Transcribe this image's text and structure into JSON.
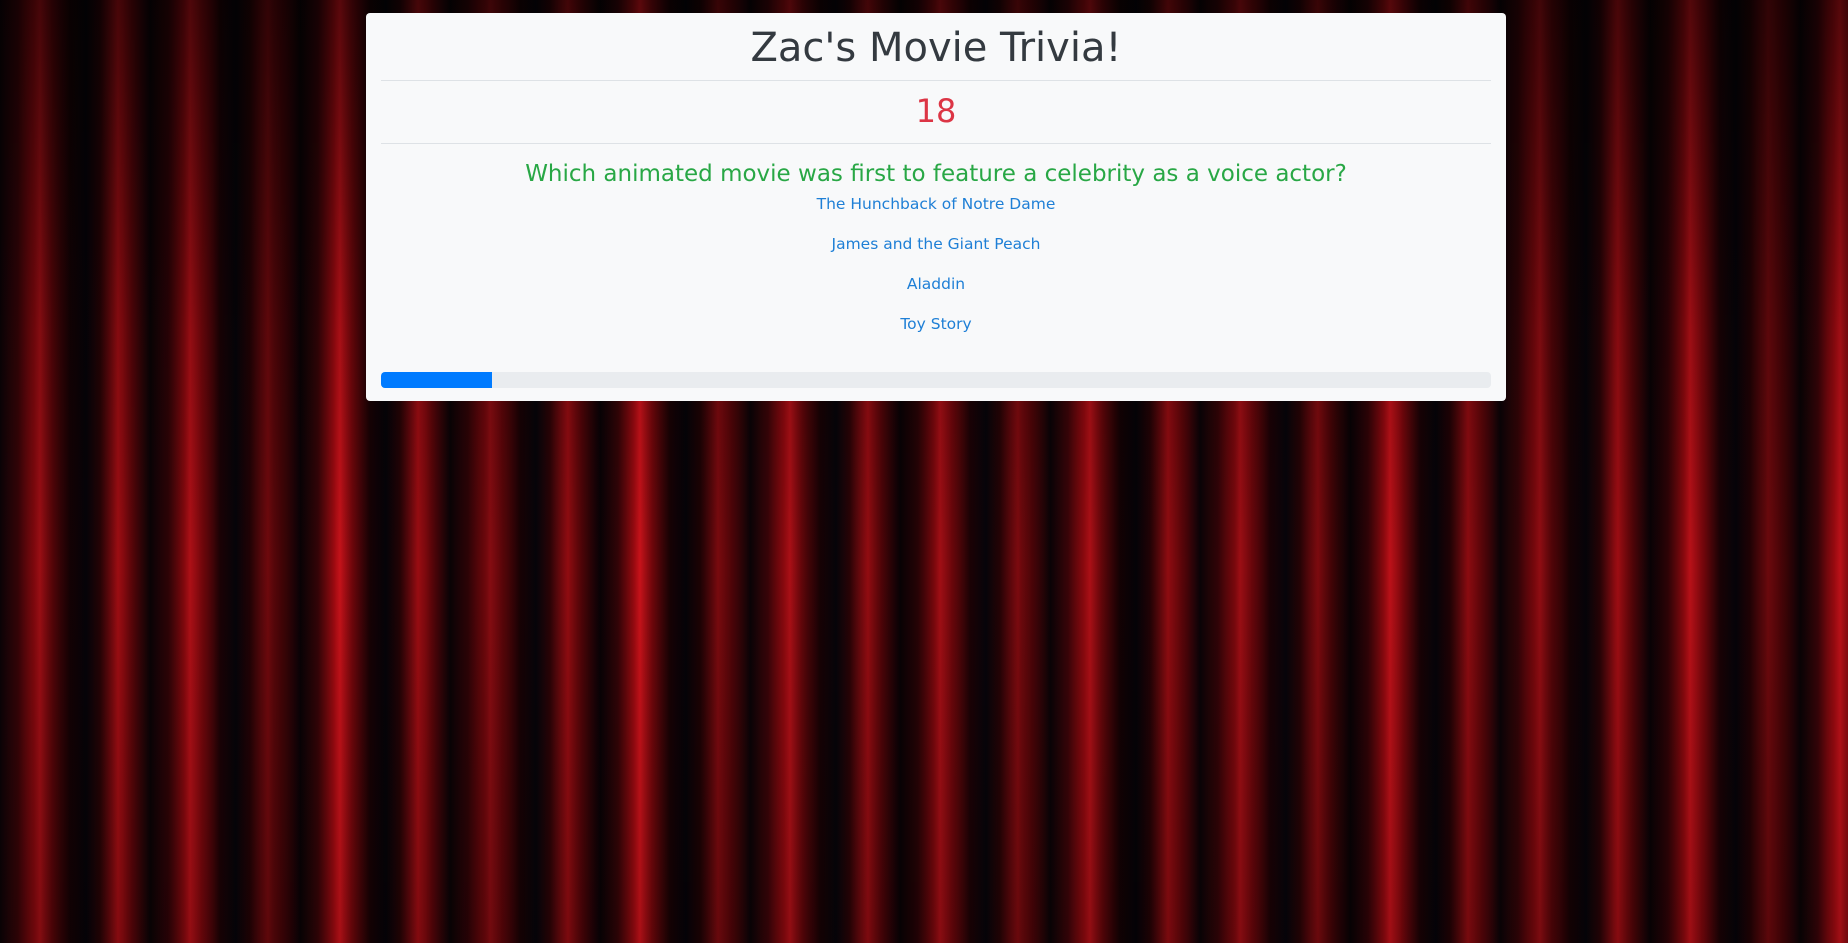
{
  "app": {
    "title": "Zac's Movie Trivia!"
  },
  "timer": {
    "value": "18"
  },
  "question": {
    "text": "Which animated movie was first to feature a celebrity as a voice actor?",
    "answers": [
      "The Hunchback of Notre Dame",
      "James and the Giant Peach",
      "Aladdin",
      "Toy Story"
    ]
  },
  "progress": {
    "fraction": 0.1
  },
  "colors": {
    "title": "#343a40",
    "timer": "#dc3545",
    "question": "#28a745",
    "answer_link": "#1e7fd6",
    "progress_fill": "#007bff",
    "progress_track": "#e9ecef",
    "card_background": "#f8f9fa"
  }
}
